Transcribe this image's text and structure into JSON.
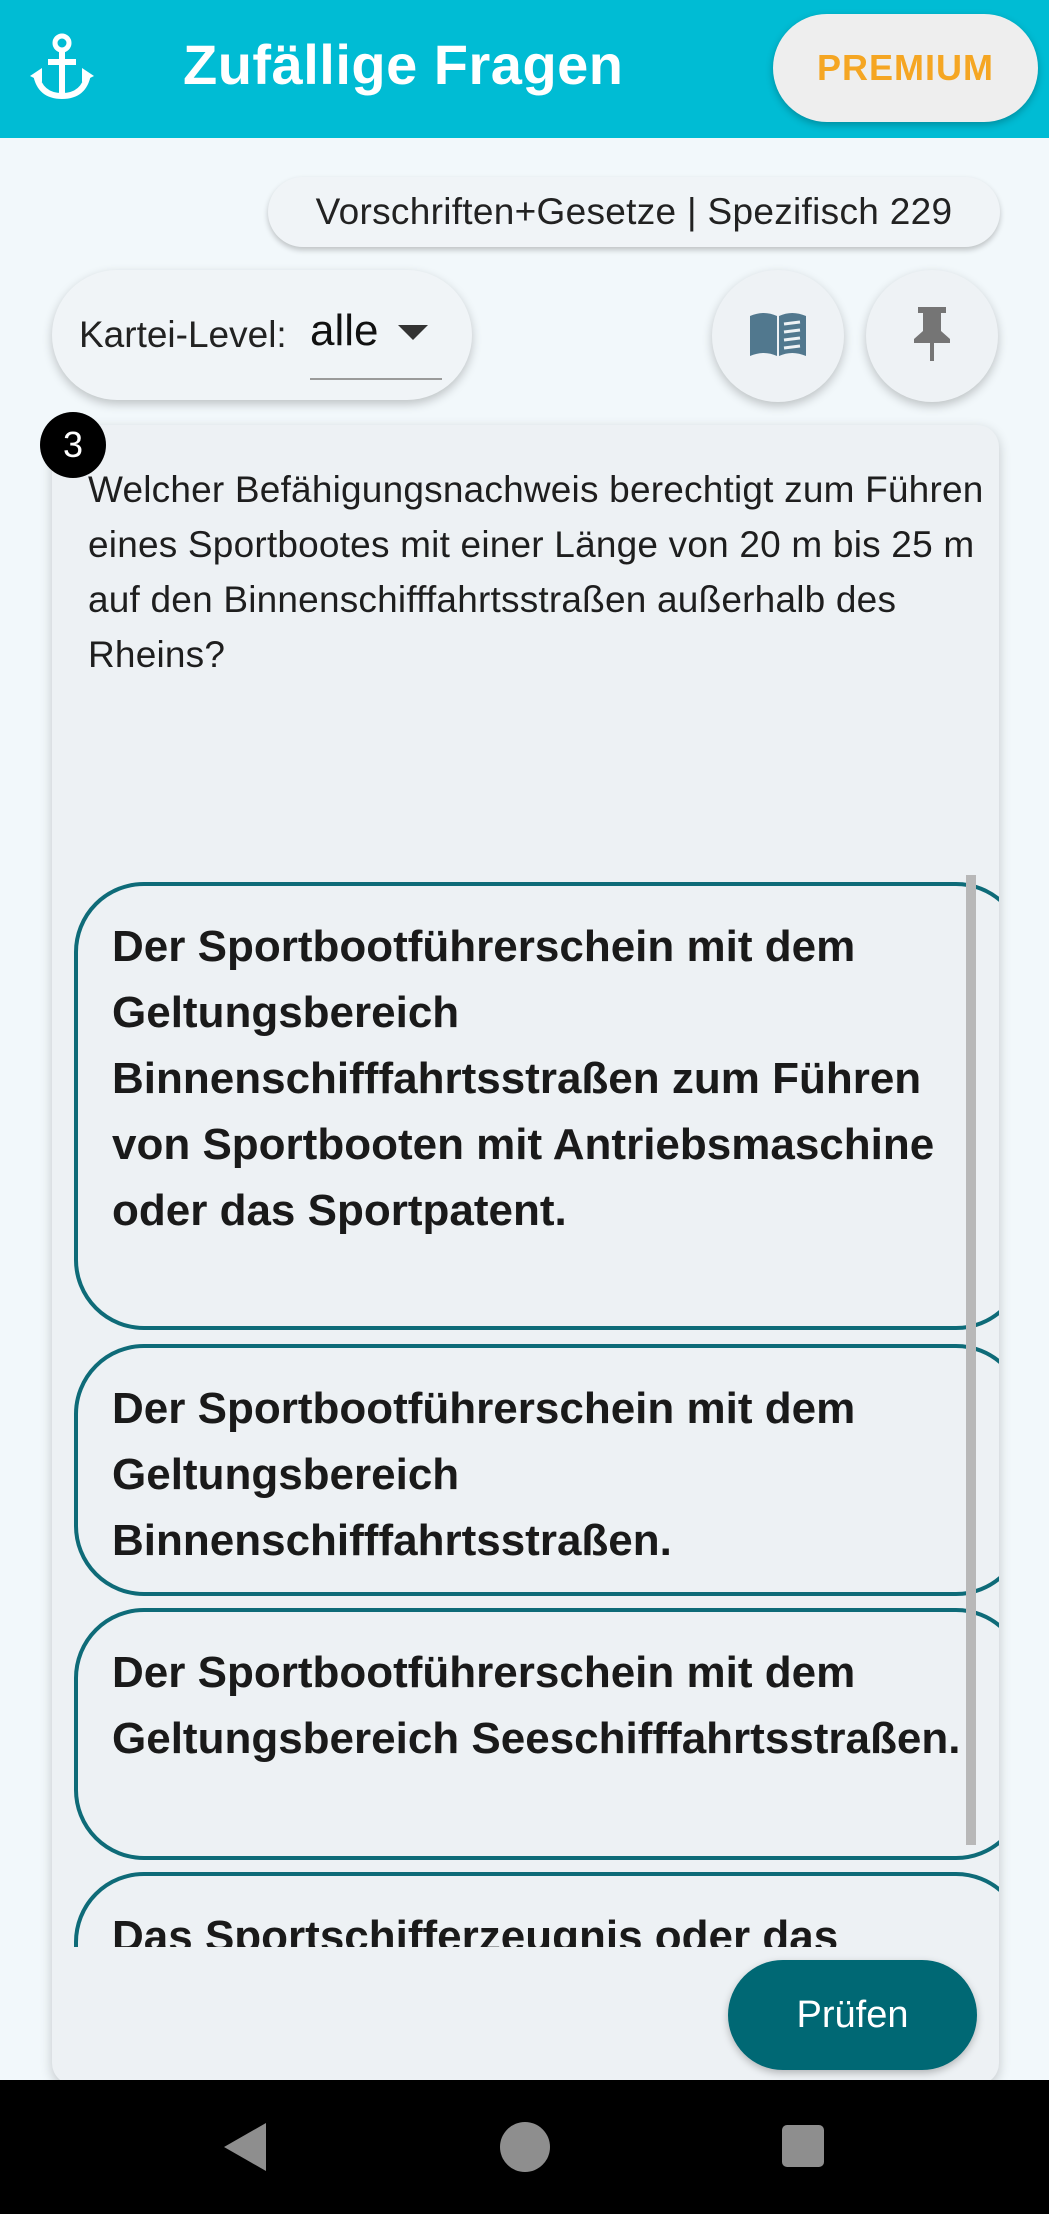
{
  "app": {
    "title": "Zufällige Fragen",
    "premium_label": "PREMIUM",
    "menu_icon": "anchor-icon",
    "accent_color": "#00bcd4",
    "premium_color": "#f5a623"
  },
  "category": {
    "label": "Vorschriften+Gesetze | Spezifisch 229"
  },
  "filter": {
    "label": "Kartei-Level:",
    "value": "alle"
  },
  "toolbar": {
    "book_icon": "book-open-icon",
    "pin_icon": "pin-icon"
  },
  "question": {
    "number": "3",
    "text": "Welcher Befähigungsnachweis berechtigt zum Führen eines Sportbootes mit einer Länge von 20 m bis 25 m auf den Binnenschifffahrtsstraßen außerhalb des Rheins?"
  },
  "answers": [
    {
      "text": "Der Sportbootführerschein mit dem Geltungsbereich Binnenschifffahrtsstraßen zum Führen von Sportbooten mit Antriebsmaschine oder das Sportpatent."
    },
    {
      "text": "Der Sportbootführerschein mit dem Geltungsbereich Binnenschifffahrtsstraßen."
    },
    {
      "text": "Der Sportbootführerschein mit dem Geltungsbereich Seeschifffahrtsstraßen."
    },
    {
      "text": "Das Sportschifferzeugnis oder das"
    }
  ],
  "actions": {
    "check_label": "Prüfen",
    "check_color": "#006874"
  },
  "system_nav": {
    "back_icon": "back-triangle-icon",
    "home_icon": "home-circle-icon",
    "recents_icon": "recents-square-icon"
  }
}
